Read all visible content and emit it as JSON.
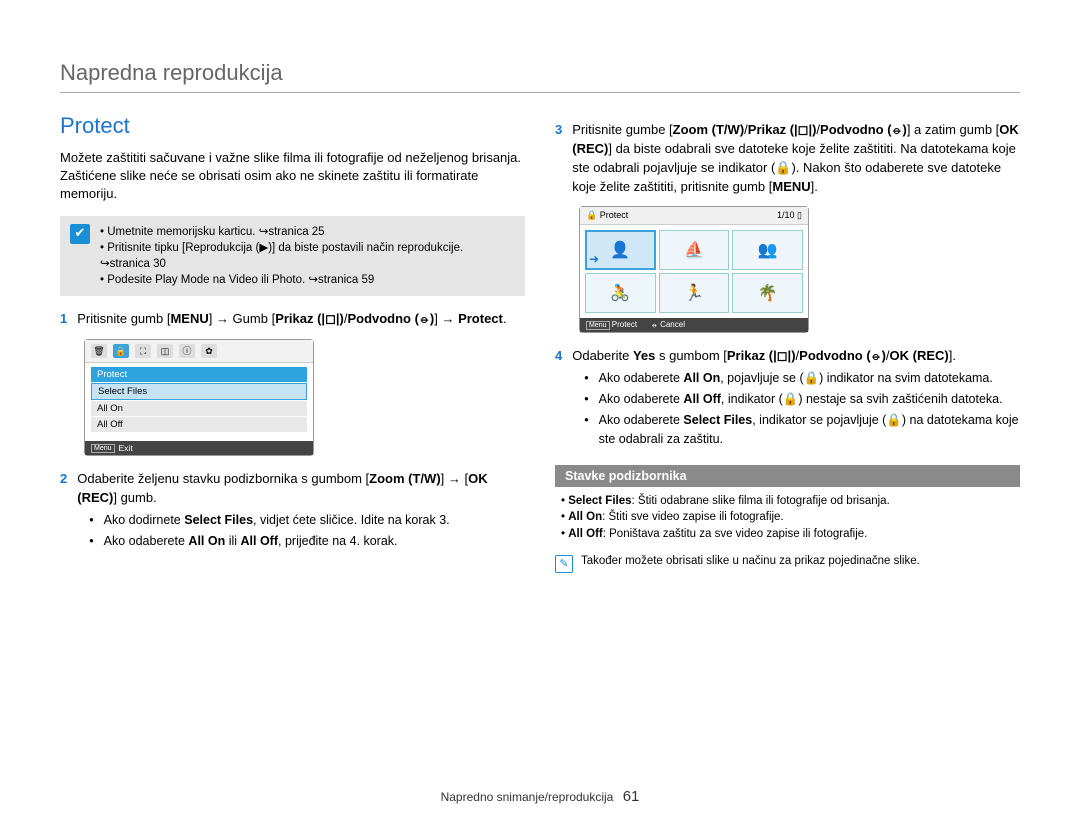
{
  "header": {
    "title": "Napredna reprodukcija"
  },
  "section": {
    "title": "Protect"
  },
  "intro": "Možete zaštititi sačuvane i važne slike filma ili fotografije od neželjenog brisanja. Zaštićene slike neće se obrisati osim ako ne skinete zaštitu ili formatirate memoriju.",
  "tips": [
    "Umetnite memorijsku karticu. ↪stranica 25",
    "Pritisnite tipku [Reprodukcija (▶)] da biste postavili način reprodukcije. ↪stranica 30",
    "Podesite Play Mode na Video ili Photo. ↪stranica 59"
  ],
  "step1": {
    "num": "1",
    "part1": "Pritisnite gumb [",
    "menu": "MENU",
    "part2": "] → Gumb [",
    "prikaz": "Prikaz (|◻|)",
    "part3": "/",
    "podvodno": "Podvodno (⦵)",
    "part4": "] → ",
    "protect": "Protect",
    "part5": "."
  },
  "ss1": {
    "header": "Protect",
    "rows": [
      "Select Files",
      "All On",
      "All Off"
    ],
    "footer_label": "Exit",
    "footer_key": "Menu"
  },
  "step2": {
    "num": "2",
    "part1": "Odaberite željenu stavku podizbornika s gumbom [",
    "zoom": "Zoom (T/W)",
    "part2": "] → [",
    "okrec": "OK (REC)",
    "part3": "] gumb.",
    "b1a": "Ako dodirnete ",
    "b1b": "Select Files",
    "b1c": ", vidjet ćete sličice. Idite na korak 3.",
    "b2a": "Ako odaberete ",
    "b2b": "All On",
    "b2c": " ili ",
    "b2d": "All Off",
    "b2e": ", prijeđite na 4. korak."
  },
  "step3": {
    "num": "3",
    "part1": "Pritisnite gumbe [",
    "zoom": "Zoom (T/W)",
    "part2": "/",
    "prikaz": "Prikaz (|◻|)",
    "part3": "/",
    "podvodno": "Podvodno (⦵)",
    "part4": "] a zatim gumb [",
    "okrec": "OK (REC)",
    "part5": "] da biste odabrali sve datoteke koje želite zaštititi. Na datotekama koje ste odabrali pojavljuje se indikator (🔒). Nakon što odaberete sve datoteke koje želite zaštititi, pritisnite gumb [",
    "menu": "MENU",
    "part6": "]."
  },
  "ss2": {
    "title": "Protect",
    "counter": "1/10",
    "foot1_icon": "Menu",
    "foot1": "Protect",
    "foot2_icon": "⦵",
    "foot2": "Cancel"
  },
  "step4": {
    "num": "4",
    "part1": "Odaberite ",
    "yes": "Yes",
    "part2": " s gumbom [",
    "prikaz": "Prikaz (|◻|)",
    "part3": "/",
    "podvodno": "Podvodno (⦵)",
    "part4": "/",
    "ok": "OK (REC)",
    "part5": "].",
    "b1a": "Ako odaberete ",
    "b1b": "All On",
    "b1c": ", pojavljuje se (🔒) indikator na svim datotekama.",
    "b2a": "Ako odaberete ",
    "b2b": "All Off",
    "b2c": ", indikator (🔒) nestaje sa svih zaštićenih datoteka.",
    "b3a": "Ako odaberete ",
    "b3b": "Select Files",
    "b3c": ", indikator se pojavljuje (🔒) na datotekama koje ste odabrali za zaštitu."
  },
  "subhead": "Stavke podizbornika",
  "sublist": {
    "l1a": "Select Files",
    "l1b": ": Štiti odabrane slike filma ili fotografije od brisanja.",
    "l2a": "All On",
    "l2b": ": Štiti sve video zapise ili fotografije.",
    "l3a": "All Off",
    "l3b": ": Poništava zaštitu za sve video zapise ili fotografije."
  },
  "note": "Također možete obrisati slike u načinu za prikaz pojedinačne slike.",
  "footer": {
    "section": "Napredno snimanje/reprodukcija",
    "page": "61"
  }
}
